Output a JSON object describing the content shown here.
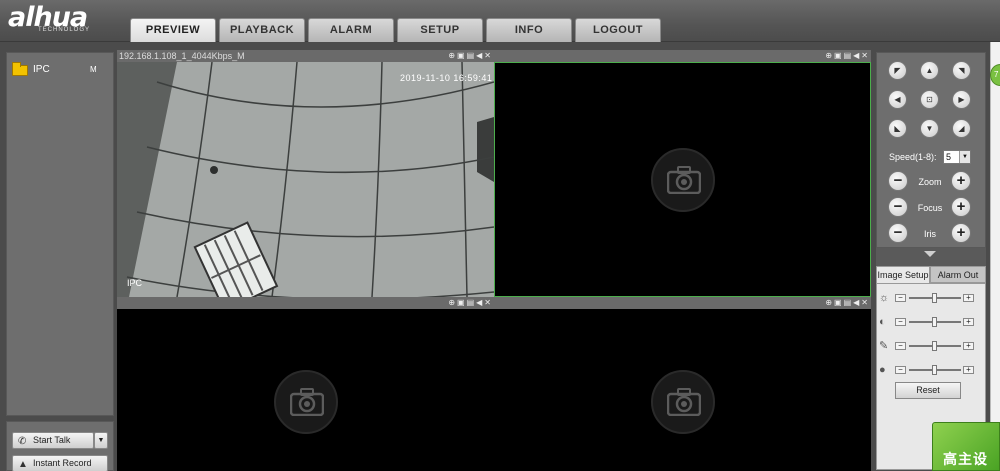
{
  "brand": {
    "logo": "alhua",
    "tagline": "TECHNOLOGY"
  },
  "nav": {
    "tabs": [
      {
        "label": "PREVIEW"
      },
      {
        "label": "PLAYBACK"
      },
      {
        "label": "ALARM"
      },
      {
        "label": "SETUP"
      },
      {
        "label": "INFO"
      },
      {
        "label": "LOGOUT"
      }
    ]
  },
  "devices": {
    "items": [
      {
        "label": "IPC",
        "badge": "M"
      }
    ]
  },
  "bottom_controls": {
    "talk_label": "Start Talk",
    "record_label": "Instant Record"
  },
  "video": {
    "cells": [
      {
        "title": "192.168.1.108_1_4044Kbps_M",
        "osd_time": "2019-11-10 16:59:41",
        "osd_name": "IPC"
      },
      {
        "title": ""
      },
      {
        "title": ""
      },
      {
        "title": ""
      }
    ],
    "cell_controls": [
      "zoom-in-icon",
      "snapshot-icon",
      "record-icon",
      "audio-icon",
      "close-icon"
    ]
  },
  "ptz": {
    "speed_label": "Speed(1-8):",
    "speed_value": "5",
    "zoom_label": "Zoom",
    "focus_label": "Focus",
    "iris_label": "Iris"
  },
  "image_panel": {
    "tab_setup": "Image Setup",
    "tab_alarm": "Alarm Out",
    "adjustments": [
      {
        "icon": "brightness-icon",
        "level": 0.5
      },
      {
        "icon": "contrast-icon",
        "level": 0.5
      },
      {
        "icon": "saturation-icon",
        "level": 0.5
      },
      {
        "icon": "hue-icon",
        "level": 0.5
      }
    ],
    "reset_label": "Reset"
  },
  "promo": {
    "text": "高主设",
    "bubble": "7"
  },
  "colors": {
    "selected_border": "#4cae4c",
    "header": "#555555",
    "panel": "#6e6e6e"
  }
}
